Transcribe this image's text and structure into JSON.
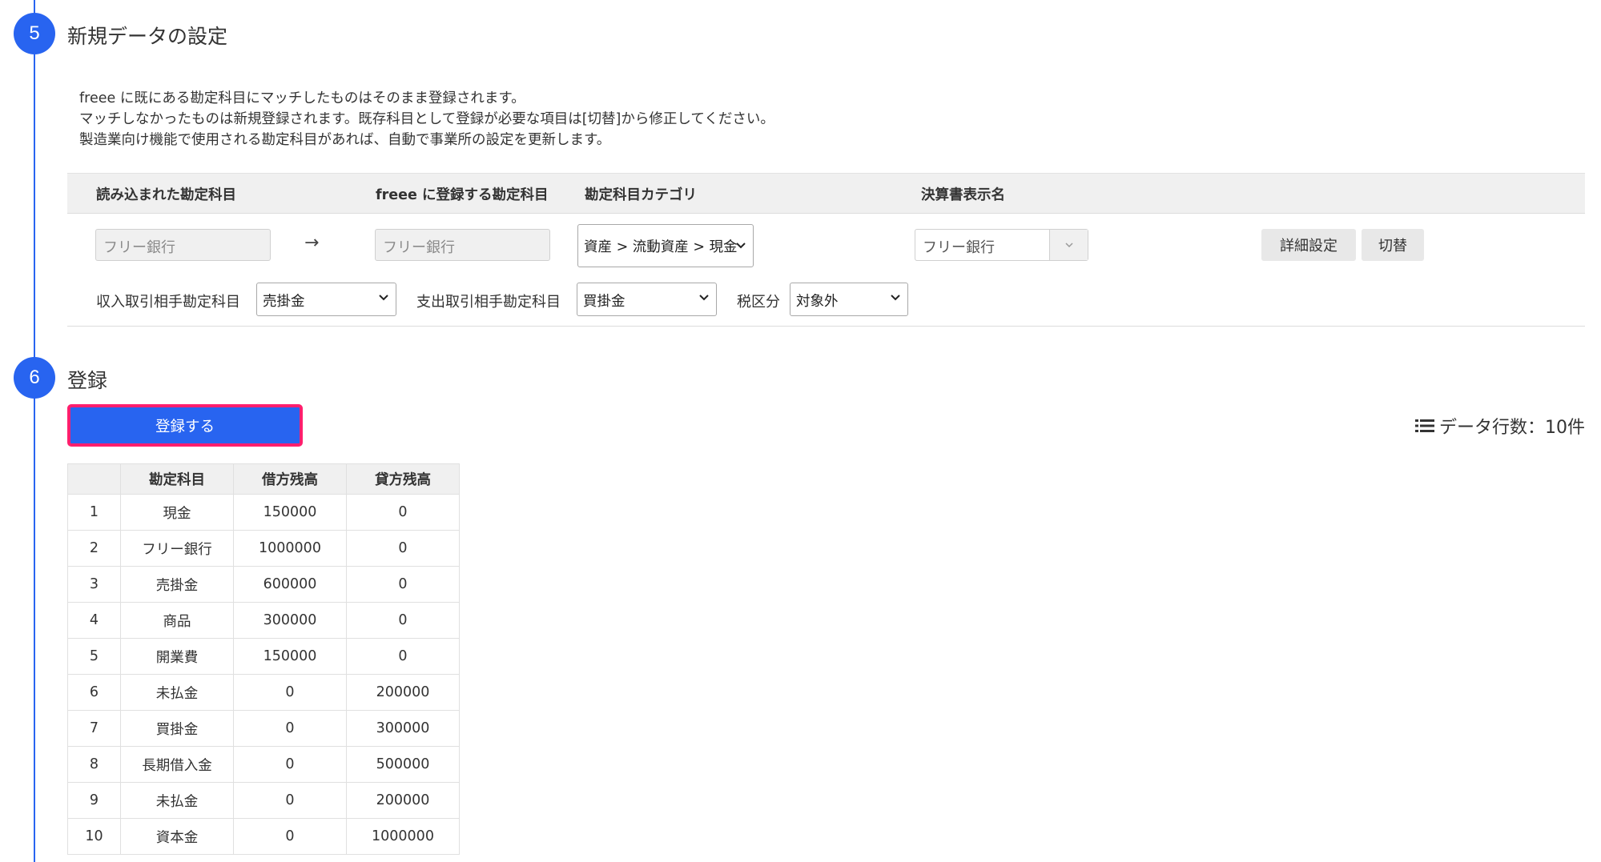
{
  "steps": [
    {
      "number": "5",
      "title": "新規データの設定"
    },
    {
      "number": "6",
      "title": "登録"
    }
  ],
  "description": [
    "freee に既にある勘定科目にマッチしたものはそのまま登録されます。",
    "マッチしなかったものは新規登録されます。既存科目として登録が必要な項目は[切替]から修正してください。",
    "製造業向け機能で使用される勘定科目があれば、自動で事業所の設定を更新します。"
  ],
  "mapping": {
    "headers": {
      "imported": "読み込まれた勘定科目",
      "freee_account": "freee に登録する勘定科目",
      "category": "勘定科目カテゴリ",
      "statement_name": "決算書表示名"
    },
    "imported_value": "フリー銀行",
    "arrow": "→",
    "freee_value": "フリー銀行",
    "category_value": "資産 > 流動資産 > 現金",
    "statement_value": "フリー銀行",
    "detail_button": "詳細設定",
    "switch_button": "切替",
    "income_label": "収入取引相手勘定科目",
    "income_value": "売掛金",
    "expense_label": "支出取引相手勘定科目",
    "expense_value": "買掛金",
    "tax_label": "税区分",
    "tax_value": "対象外"
  },
  "register_button": "登録する",
  "row_count": "データ行数：10件",
  "table": {
    "headers": [
      "",
      "勘定科目",
      "借方残高",
      "貸方残高"
    ],
    "rows": [
      [
        "1",
        "現金",
        "150000",
        "0"
      ],
      [
        "2",
        "フリー銀行",
        "1000000",
        "0"
      ],
      [
        "3",
        "売掛金",
        "600000",
        "0"
      ],
      [
        "4",
        "商品",
        "300000",
        "0"
      ],
      [
        "5",
        "開業費",
        "150000",
        "0"
      ],
      [
        "6",
        "未払金",
        "0",
        "200000"
      ],
      [
        "7",
        "買掛金",
        "0",
        "300000"
      ],
      [
        "8",
        "長期借入金",
        "0",
        "500000"
      ],
      [
        "9",
        "未払金",
        "0",
        "200000"
      ],
      [
        "10",
        "資本金",
        "0",
        "1000000"
      ]
    ]
  },
  "colors": {
    "accent": "#2864f0",
    "highlight_border": "#ff1f6e"
  }
}
